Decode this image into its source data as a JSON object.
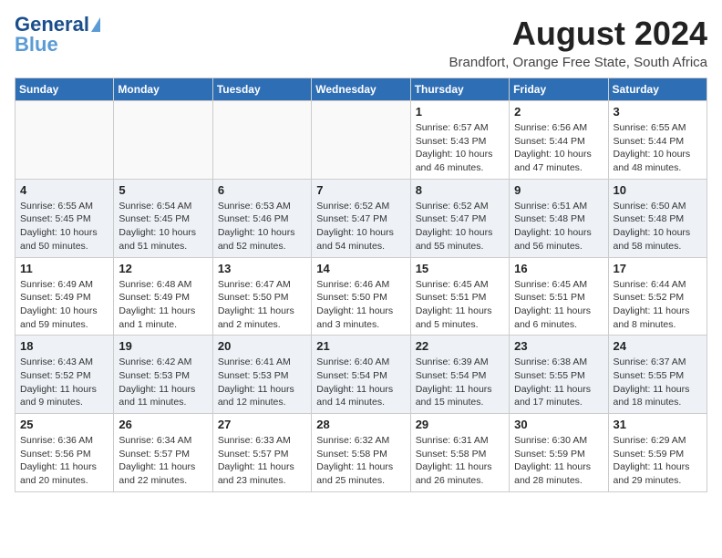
{
  "header": {
    "logo_line1": "General",
    "logo_line2": "Blue",
    "main_title": "August 2024",
    "subtitle": "Brandfort, Orange Free State, South Africa"
  },
  "calendar": {
    "days_of_week": [
      "Sunday",
      "Monday",
      "Tuesday",
      "Wednesday",
      "Thursday",
      "Friday",
      "Saturday"
    ],
    "weeks": [
      {
        "days": [
          {
            "number": "",
            "info": ""
          },
          {
            "number": "",
            "info": ""
          },
          {
            "number": "",
            "info": ""
          },
          {
            "number": "",
            "info": ""
          },
          {
            "number": "1",
            "info": "Sunrise: 6:57 AM\nSunset: 5:43 PM\nDaylight: 10 hours\nand 46 minutes."
          },
          {
            "number": "2",
            "info": "Sunrise: 6:56 AM\nSunset: 5:44 PM\nDaylight: 10 hours\nand 47 minutes."
          },
          {
            "number": "3",
            "info": "Sunrise: 6:55 AM\nSunset: 5:44 PM\nDaylight: 10 hours\nand 48 minutes."
          }
        ]
      },
      {
        "days": [
          {
            "number": "4",
            "info": "Sunrise: 6:55 AM\nSunset: 5:45 PM\nDaylight: 10 hours\nand 50 minutes."
          },
          {
            "number": "5",
            "info": "Sunrise: 6:54 AM\nSunset: 5:45 PM\nDaylight: 10 hours\nand 51 minutes."
          },
          {
            "number": "6",
            "info": "Sunrise: 6:53 AM\nSunset: 5:46 PM\nDaylight: 10 hours\nand 52 minutes."
          },
          {
            "number": "7",
            "info": "Sunrise: 6:52 AM\nSunset: 5:47 PM\nDaylight: 10 hours\nand 54 minutes."
          },
          {
            "number": "8",
            "info": "Sunrise: 6:52 AM\nSunset: 5:47 PM\nDaylight: 10 hours\nand 55 minutes."
          },
          {
            "number": "9",
            "info": "Sunrise: 6:51 AM\nSunset: 5:48 PM\nDaylight: 10 hours\nand 56 minutes."
          },
          {
            "number": "10",
            "info": "Sunrise: 6:50 AM\nSunset: 5:48 PM\nDaylight: 10 hours\nand 58 minutes."
          }
        ]
      },
      {
        "days": [
          {
            "number": "11",
            "info": "Sunrise: 6:49 AM\nSunset: 5:49 PM\nDaylight: 10 hours\nand 59 minutes."
          },
          {
            "number": "12",
            "info": "Sunrise: 6:48 AM\nSunset: 5:49 PM\nDaylight: 11 hours\nand 1 minute."
          },
          {
            "number": "13",
            "info": "Sunrise: 6:47 AM\nSunset: 5:50 PM\nDaylight: 11 hours\nand 2 minutes."
          },
          {
            "number": "14",
            "info": "Sunrise: 6:46 AM\nSunset: 5:50 PM\nDaylight: 11 hours\nand 3 minutes."
          },
          {
            "number": "15",
            "info": "Sunrise: 6:45 AM\nSunset: 5:51 PM\nDaylight: 11 hours\nand 5 minutes."
          },
          {
            "number": "16",
            "info": "Sunrise: 6:45 AM\nSunset: 5:51 PM\nDaylight: 11 hours\nand 6 minutes."
          },
          {
            "number": "17",
            "info": "Sunrise: 6:44 AM\nSunset: 5:52 PM\nDaylight: 11 hours\nand 8 minutes."
          }
        ]
      },
      {
        "days": [
          {
            "number": "18",
            "info": "Sunrise: 6:43 AM\nSunset: 5:52 PM\nDaylight: 11 hours\nand 9 minutes."
          },
          {
            "number": "19",
            "info": "Sunrise: 6:42 AM\nSunset: 5:53 PM\nDaylight: 11 hours\nand 11 minutes."
          },
          {
            "number": "20",
            "info": "Sunrise: 6:41 AM\nSunset: 5:53 PM\nDaylight: 11 hours\nand 12 minutes."
          },
          {
            "number": "21",
            "info": "Sunrise: 6:40 AM\nSunset: 5:54 PM\nDaylight: 11 hours\nand 14 minutes."
          },
          {
            "number": "22",
            "info": "Sunrise: 6:39 AM\nSunset: 5:54 PM\nDaylight: 11 hours\nand 15 minutes."
          },
          {
            "number": "23",
            "info": "Sunrise: 6:38 AM\nSunset: 5:55 PM\nDaylight: 11 hours\nand 17 minutes."
          },
          {
            "number": "24",
            "info": "Sunrise: 6:37 AM\nSunset: 5:55 PM\nDaylight: 11 hours\nand 18 minutes."
          }
        ]
      },
      {
        "days": [
          {
            "number": "25",
            "info": "Sunrise: 6:36 AM\nSunset: 5:56 PM\nDaylight: 11 hours\nand 20 minutes."
          },
          {
            "number": "26",
            "info": "Sunrise: 6:34 AM\nSunset: 5:57 PM\nDaylight: 11 hours\nand 22 minutes."
          },
          {
            "number": "27",
            "info": "Sunrise: 6:33 AM\nSunset: 5:57 PM\nDaylight: 11 hours\nand 23 minutes."
          },
          {
            "number": "28",
            "info": "Sunrise: 6:32 AM\nSunset: 5:58 PM\nDaylight: 11 hours\nand 25 minutes."
          },
          {
            "number": "29",
            "info": "Sunrise: 6:31 AM\nSunset: 5:58 PM\nDaylight: 11 hours\nand 26 minutes."
          },
          {
            "number": "30",
            "info": "Sunrise: 6:30 AM\nSunset: 5:59 PM\nDaylight: 11 hours\nand 28 minutes."
          },
          {
            "number": "31",
            "info": "Sunrise: 6:29 AM\nSunset: 5:59 PM\nDaylight: 11 hours\nand 29 minutes."
          }
        ]
      }
    ]
  }
}
